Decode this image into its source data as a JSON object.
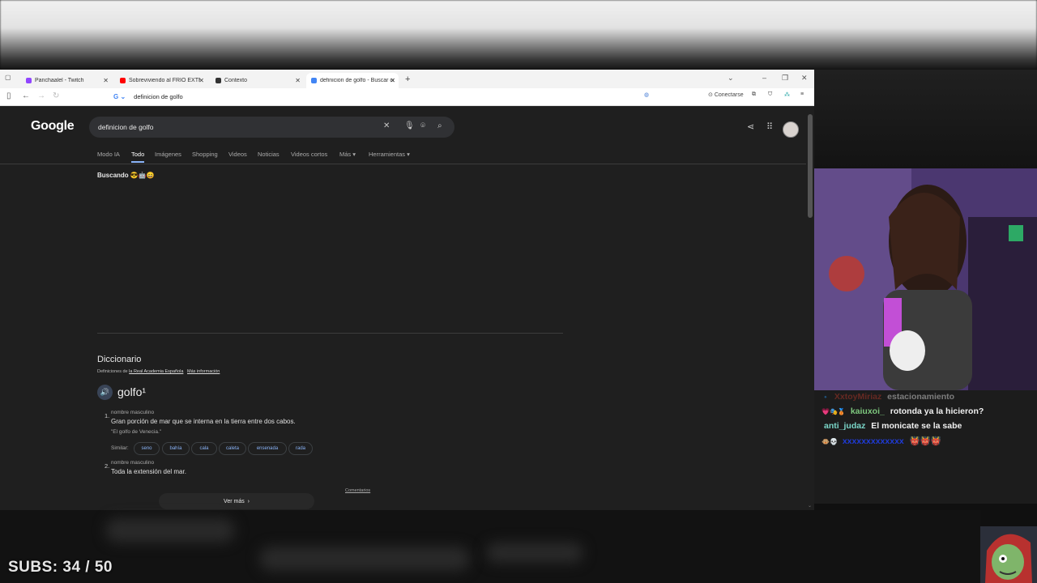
{
  "browser": {
    "tabs": [
      {
        "title": "Panchaalel - Twitch",
        "favicon_color": "#9146ff"
      },
      {
        "title": "Sobreviviendo al FRÍO EXTREM",
        "favicon_color": "#ff0000"
      },
      {
        "title": "Contexto",
        "favicon_color": "#333333"
      },
      {
        "title": "definicion de golfo - Buscar co",
        "favicon_color": "#4285f4"
      }
    ],
    "new_tab": "+",
    "address_value": "definicion de golfo",
    "connect_label": "Conectarse"
  },
  "google": {
    "logo": "Google",
    "query": "definicion de golfo",
    "tabs": [
      "Modo IA",
      "Todo",
      "Imágenes",
      "Shopping",
      "Videos",
      "Noticias",
      "Videos cortos",
      "Más ▾",
      "Herramientas ▾"
    ],
    "searching": "Buscando 😎🤖😄",
    "dictionary": {
      "title": "Diccionario",
      "source_prefix": "Definiciones de ",
      "source_link": "la Real Academia Española",
      "more_info": "Más información",
      "word": "golfo¹",
      "senses": [
        {
          "num": "1.",
          "pos": "nombre masculino",
          "definition": "Gran porción de mar que se interna en la tierra entre dos cabos.",
          "example": "\"El golfo de Venecia.\""
        },
        {
          "num": "2.",
          "pos": "nombre masculino",
          "definition": "Toda la extensión del mar."
        }
      ],
      "similar_label": "Similar:",
      "similar": [
        "seno",
        "bahía",
        "cala",
        "caleta",
        "ensenada",
        "rada"
      ],
      "comments": "Comentarios",
      "see_more": "Ver más"
    }
  },
  "chat": {
    "messages": [
      {
        "badges": "🔹",
        "user": "XxtoyMiriaz",
        "text": "estacionamiento",
        "user_color": "#c0392b"
      },
      {
        "badges": "💗🎭🥉",
        "user": "kaiuxoi_",
        "text": "rotonda ya la hicieron?",
        "user_color": "#7ec87e"
      },
      {
        "badges": "",
        "user": "anti_judaz",
        "text": "El monicate se la sabe",
        "user_color": "#7ad6c8"
      },
      {
        "badges": "🐵💀",
        "user": "xxxxxxxxxxxxx",
        "text": "👹👹👹",
        "user_color": "#1f3bd6"
      }
    ]
  },
  "overlay": {
    "subs": "SUBS: 34 / 50"
  }
}
